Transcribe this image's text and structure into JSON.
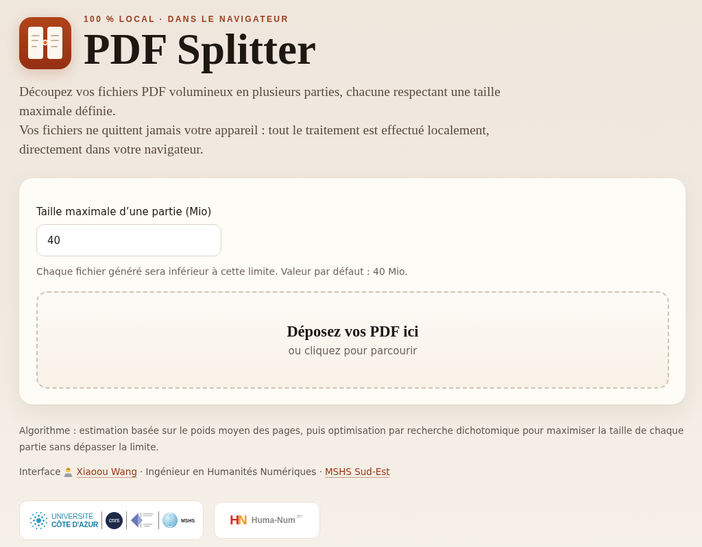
{
  "header": {
    "eyebrow": "100 % LOCAL · DANS LE NAVIGATEUR",
    "title": "PDF Splitter"
  },
  "intro": [
    "Découpez vos fichiers PDF volumineux en plusieurs parties, chacune respectant une taille maximale définie.",
    "Vos fichiers ne quittent jamais votre appareil : tout le traitement est effectué localement, directement dans votre navigateur."
  ],
  "settings": {
    "label": "Taille maximale d’une partie (Mio)",
    "value": "40",
    "hint": "Chaque fichier généré sera inférieur à cette limite. Valeur par défaut : 40 Mio."
  },
  "dropzone": {
    "title": "Déposez vos PDF ici",
    "subtitle": "ou cliquez pour parcourir"
  },
  "footer": {
    "algorithm": "Algorithme : estimation basée sur le poids moyen des pages, puis optimisation par recherche dichotomique pour maximiser la taille de chaque partie sans dépasser la limite.",
    "credits": {
      "prefix": "Interface",
      "author": "Xiaoou Wang",
      "role": "· Ingénieur en Humanités Numériques ·",
      "lab": "MSHS Sud-Est"
    }
  },
  "partners": [
    {
      "kind": "group",
      "logos": [
        {
          "kind": "wordmark",
          "lines": [
            "UNIVERSITÉ",
            "CÔTE D'AZUR"
          ]
        },
        {
          "kind": "roundel",
          "text": "cnrs"
        },
        {
          "kind": "emblem"
        },
        {
          "kind": "sphere",
          "text": "MSHS"
        }
      ]
    },
    {
      "kind": "single",
      "logos": [
        {
          "kind": "letters",
          "mark": "HN",
          "name": "Huma-Num",
          "suffix": "IR*"
        }
      ]
    }
  ]
}
